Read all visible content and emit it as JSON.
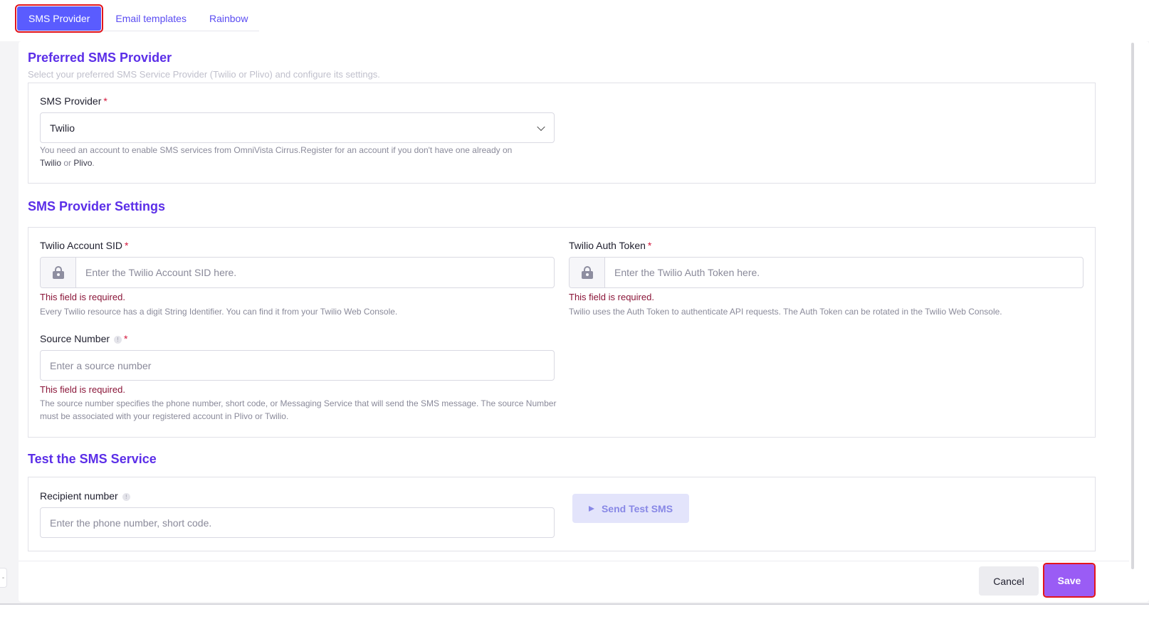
{
  "tabs": [
    {
      "label": "SMS Provider"
    },
    {
      "label": "Email templates"
    },
    {
      "label": "Rainbow"
    }
  ],
  "preferred": {
    "title": "Preferred SMS Provider",
    "subtitle": "Select your preferred SMS Service Provider (Twilio or Plivo) and configure its settings.",
    "provider_label": "SMS Provider",
    "required_mark": "*",
    "provider_value": "Twilio",
    "help_text": "You need an account to enable SMS services from OmniVista Cirrus.Register for an account if you don't have one already on",
    "link_twilio": "Twilio",
    "link_or": "or",
    "link_plivo": "Plivo",
    "period": "."
  },
  "settings": {
    "title": "SMS Provider Settings",
    "sid_label": "Twilio Account SID",
    "sid_placeholder": "Enter the Twilio Account SID here.",
    "sid_error": "This field is required.",
    "sid_help": "Every Twilio resource has a digit String Identifier. You can find it from your Twilio Web Console.",
    "token_label": "Twilio Auth Token",
    "token_placeholder": "Enter the Twilio Auth Token here.",
    "token_error": "This field is required.",
    "token_help": "Twilio uses the Auth Token to authenticate API requests. The Auth Token can be rotated in the Twilio Web Console.",
    "source_label": "Source Number",
    "source_placeholder": "Enter a source number",
    "source_error": "This field is required.",
    "source_help": "The source number specifies the phone number, short code, or Messaging Service that will send the SMS message. The source Number must be associated with your registered account in Plivo or Twilio.",
    "info_glyph": "!"
  },
  "test": {
    "title": "Test the SMS Service",
    "recipient_label": "Recipient number",
    "recipient_placeholder": "Enter the phone number, short code.",
    "send_label": "Send Test SMS"
  },
  "footer": {
    "cancel_label": "Cancel",
    "save_label": "Save"
  },
  "side_handle_glyph": "-",
  "colors": {
    "accent": "#5b2ee8",
    "tab_active": "#5a5cff",
    "save": "#9a5cf5",
    "error": "#8a1538",
    "required": "#d4183d",
    "highlight": "#e3151c"
  }
}
